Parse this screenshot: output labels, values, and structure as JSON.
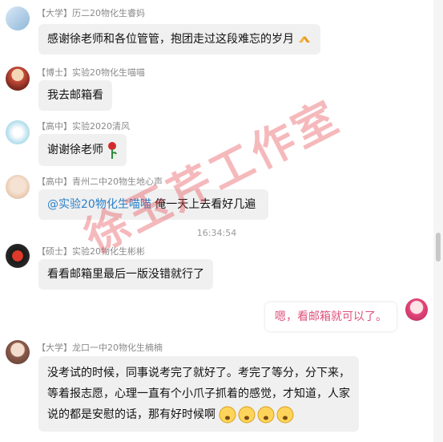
{
  "messages": [
    {
      "tag": "【大学】",
      "name": "历二20物化生睿妈",
      "text": "感谢徐老师和各位管管，抱团走过这段难忘的岁月"
    },
    {
      "tag": "【博士】",
      "name": "实验20物化生喵喵",
      "text": "我去邮箱看"
    },
    {
      "tag": "【高中】",
      "name": "实验2020清风",
      "text": "谢谢徐老师"
    },
    {
      "tag": "【高中】",
      "name": "青州二中20物生地心声",
      "mention": "@实验20物化生喵喵",
      "text": " 俺一天上去看好几遍"
    },
    {
      "tag": "【硕士】",
      "name": "实验20物化生彬彬",
      "text": "看看邮箱里最后一版没错就行了"
    },
    {
      "tag": "【大学】",
      "name": "龙口一中20物化生楠楠",
      "lines": [
        "没考试的时候，同事说考完了就好了。考完了等分，分下来，",
        "等着报志愿，心理一直有个小爪子抓着的感觉，才知道，人家",
        "说的都是安慰的话，那有好时候啊"
      ]
    }
  ],
  "timestamp": "16:34:54",
  "self_message": "嗯，看邮箱就可以了。",
  "watermark": "徐玉芹工作室",
  "colors": {
    "mention": "#2a80c8",
    "self_text": "#e0507a",
    "bubble": "#f0f0f0"
  }
}
